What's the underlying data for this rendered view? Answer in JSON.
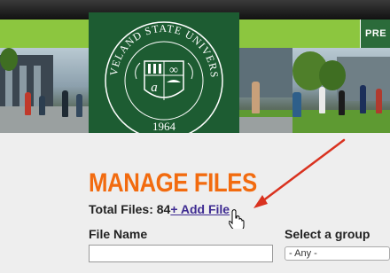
{
  "nav": {
    "pre_label": "PRE"
  },
  "logo": {
    "university_name": "CLEVELAND STATE UNIVERSITY",
    "year": "1964",
    "emblem_letter": "a",
    "emblem_symbol": "∞"
  },
  "page": {
    "title": "MANAGE FILES",
    "total_files_label": "Total Files:",
    "total_files_count": "84",
    "add_file_link": "+ Add File"
  },
  "filters": {
    "file_name_label": "File Name",
    "file_name_value": "",
    "group_label": "Select a group",
    "group_selected": "- Any -"
  },
  "colors": {
    "accent_orange": "#f26b0f",
    "brand_green": "#1d5c32",
    "nav_green": "#8cc63f",
    "link_purple": "#3d2a91",
    "annotation_red": "#d9321f"
  }
}
